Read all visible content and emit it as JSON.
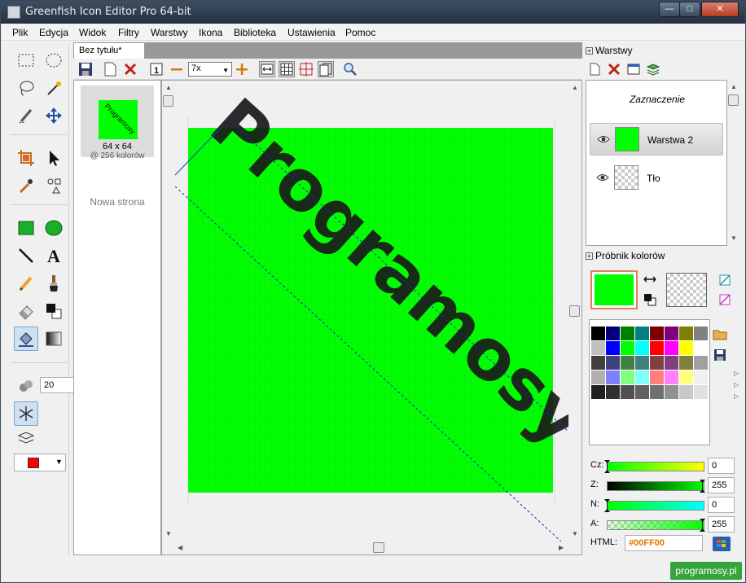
{
  "window": {
    "title": "Greenfish Icon Editor Pro 64-bit"
  },
  "menu": [
    "Plik",
    "Edycja",
    "Widok",
    "Filtry",
    "Warstwy",
    "Ikona",
    "Biblioteka",
    "Ustawienia",
    "Pomoc"
  ],
  "toolbox": {
    "brush_size": "20",
    "active_tool": "gradient-fill"
  },
  "document": {
    "tab_label": "Bez tytułu*",
    "zoom": "7x",
    "page_thumb": {
      "size": "64 x 64",
      "colors": "@ 256 kolorów",
      "thumb_text": "Programosy"
    },
    "new_page": "Nowa strona",
    "canvas_text": "Programosy"
  },
  "layers_panel": {
    "title": "Warstwy",
    "selection_label": "Zaznaczenie",
    "layers": [
      {
        "name": "Warstwa 2",
        "selected": true
      },
      {
        "name": "Tło",
        "selected": false
      }
    ]
  },
  "color_panel": {
    "title": "Próbnik kolorów",
    "primary_color": "#00ff00",
    "palette": [
      "#000000",
      "#000080",
      "#008000",
      "#008080",
      "#800000",
      "#800080",
      "#808000",
      "#808080",
      "#c0c0c0",
      "#0000ff",
      "#00ff00",
      "#00ffff",
      "#ff0000",
      "#ff00ff",
      "#ffff00",
      "#ffffff",
      "#404040",
      "#404080",
      "#408040",
      "#408080",
      "#804040",
      "#804080",
      "#808040",
      "#a0a0a0",
      "#b0b0b0",
      "#8080ff",
      "#80ff80",
      "#80ffff",
      "#ff8080",
      "#ff80ff",
      "#ffff80",
      "#f0f0f0",
      "#202020",
      "#303030",
      "#505050",
      "#606060",
      "#707070",
      "#909090",
      "#c8c8c8",
      "#e0e0e0"
    ],
    "sliders": [
      {
        "label": "Cz:",
        "value": "0"
      },
      {
        "label": "Z:",
        "value": "255"
      },
      {
        "label": "N:",
        "value": "0"
      },
      {
        "label": "A:",
        "value": "255"
      }
    ],
    "html_label": "HTML:",
    "html_value": "#00FF00"
  },
  "watermark": "programosy.pl"
}
